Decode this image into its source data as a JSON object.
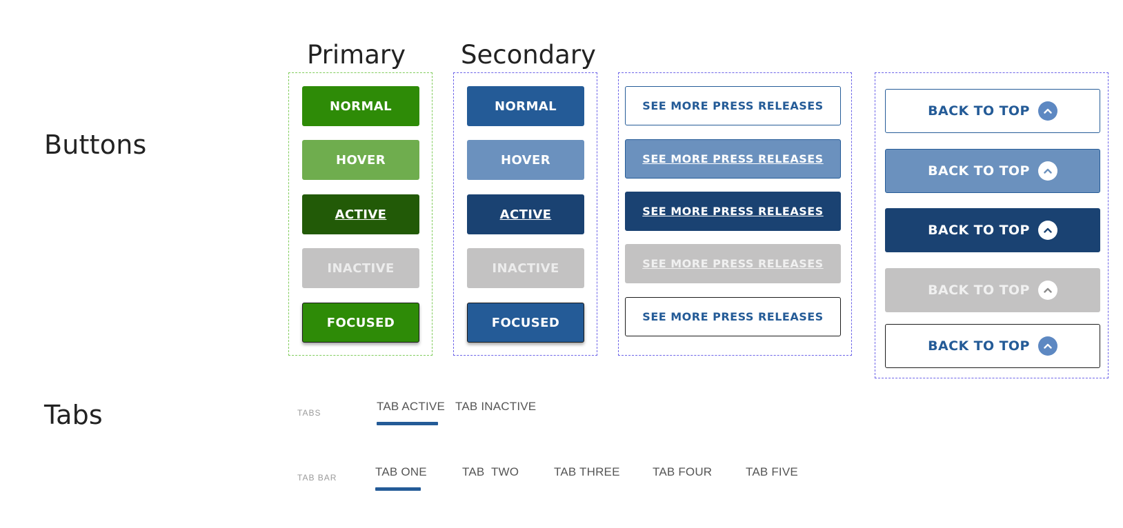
{
  "sections": {
    "buttons_title": "Buttons",
    "tabs_title": "Tabs"
  },
  "columns": {
    "primary_title": "Primary",
    "secondary_title": "Secondary"
  },
  "primary_buttons": {
    "normal": "NORMAL",
    "hover": "HOVER",
    "active": "ACTIVE",
    "inactive": "INACTIVE",
    "focused": "FOCUSED"
  },
  "secondary_buttons": {
    "normal": "NORMAL",
    "hover": "HOVER",
    "active": "ACTIVE",
    "inactive": "INACTIVE",
    "focused": "FOCUSED"
  },
  "press_buttons": {
    "label": "SEE MORE PRESS RELEASES"
  },
  "back_to_top": {
    "label": "BACK TO TOP",
    "icon": "chevron-up-icon"
  },
  "tabs": {
    "caption": "TABS",
    "active": "TAB ACTIVE",
    "inactive": "TAB INACTIVE"
  },
  "tab_bar": {
    "caption": "TAB BAR",
    "items": [
      "TAB ONE",
      "TAB  TWO",
      "TAB THREE",
      "TAB FOUR",
      "TAB FIVE"
    ]
  },
  "colors": {
    "primary_green": "#2e8b07",
    "primary_green_hover": "#6fad4e",
    "primary_green_active": "#225a07",
    "secondary_blue": "#245b97",
    "secondary_blue_hover": "#6b91be",
    "secondary_blue_active": "#1a4272",
    "inactive_gray": "#c3c2c2"
  }
}
